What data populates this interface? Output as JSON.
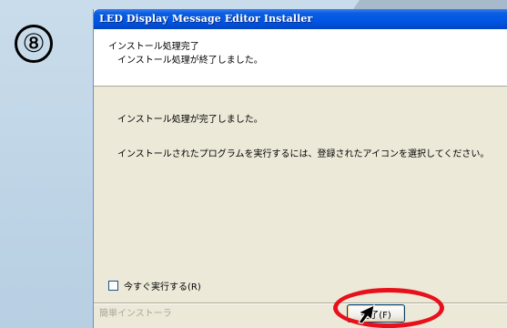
{
  "step_marker": "⑧",
  "window": {
    "title": "LED Display Message Editor Installer"
  },
  "header": {
    "title": "インストール処理完了",
    "subtitle": "インストール処理が終了しました。"
  },
  "body": {
    "line1": "インストール処理が完了しました。",
    "line2": "インストールされたプログラムを実行するには、登録されたアイコンを選択してください。"
  },
  "run_now": {
    "label": "今すぐ実行する(R)",
    "checked": false
  },
  "footer": {
    "brand": "簡単インストーラ",
    "finish_label": "完了(F)"
  },
  "colors": {
    "titlebar": "#0055e5",
    "highlight_circle": "#e8101a",
    "dialog_bg": "#ece9d8"
  },
  "icons": {
    "pointer": "arrow-pointer-icon"
  }
}
